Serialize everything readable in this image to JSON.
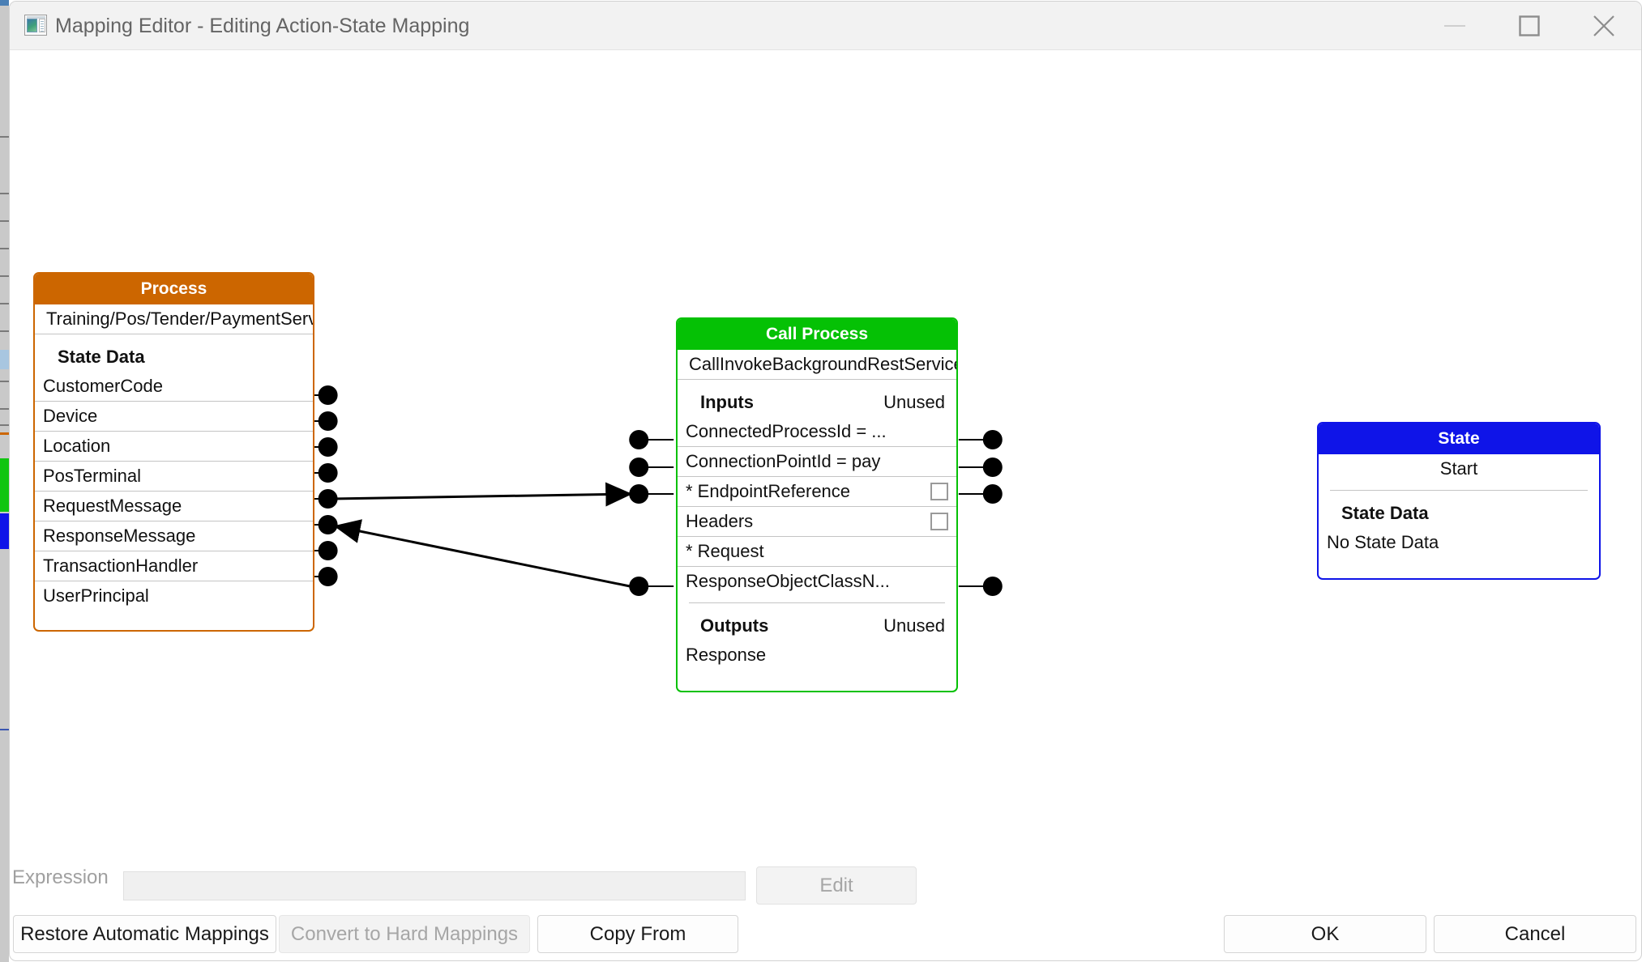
{
  "window": {
    "title": "Mapping Editor - Editing Action-State Mapping",
    "app_icon": "mapping-editor-icon",
    "controls": {
      "minimize": "minimize-icon",
      "maximize": "maximize-icon",
      "close": "close-icon"
    }
  },
  "nodes": {
    "process": {
      "header": "Process",
      "header_color": "#CC6600",
      "path": "Training/Pos/Tender/PaymentServ...",
      "section_label": "State Data",
      "items": [
        "CustomerCode",
        "Device",
        "Location",
        "PosTerminal",
        "RequestMessage",
        "ResponseMessage",
        "TransactionHandler",
        "UserPrincipal"
      ]
    },
    "call_process": {
      "header": "Call Process",
      "header_color": "#05C105",
      "name": "CallInvokeBackgroundRestService",
      "inputs_label": "Inputs",
      "inputs_status": "Unused",
      "inputs": [
        {
          "label": "ConnectedProcessId = ...",
          "checkbox": false,
          "required": false
        },
        {
          "label": "ConnectionPointId = pay",
          "checkbox": false,
          "required": false
        },
        {
          "label": "* EndpointReference",
          "checkbox": true,
          "required": true
        },
        {
          "label": "Headers",
          "checkbox": true,
          "required": false
        },
        {
          "label": "* Request",
          "checkbox": false,
          "required": true
        },
        {
          "label": "ResponseObjectClassN...",
          "checkbox": false,
          "required": false
        }
      ],
      "outputs_label": "Outputs",
      "outputs_status": "Unused",
      "outputs": [
        {
          "label": "Response"
        }
      ]
    },
    "state": {
      "header": "State",
      "header_color": "#0F14E8",
      "name": "Start",
      "section_label": "State Data",
      "items": [
        "No State Data"
      ]
    }
  },
  "connections": [
    {
      "from": "process.RequestMessage",
      "to": "call_process.Request",
      "direction": "right"
    },
    {
      "from": "call_process.Response",
      "to": "process.ResponseMessage",
      "direction": "left"
    }
  ],
  "bottom": {
    "expression_label": "Expression",
    "expression_value": "",
    "expression_placeholder": "",
    "edit_label": "Edit",
    "restore_label": "Restore Automatic Mappings",
    "convert_label": "Convert to Hard Mappings",
    "copy_from_label": "Copy From",
    "ok_label": "OK",
    "cancel_label": "Cancel"
  }
}
